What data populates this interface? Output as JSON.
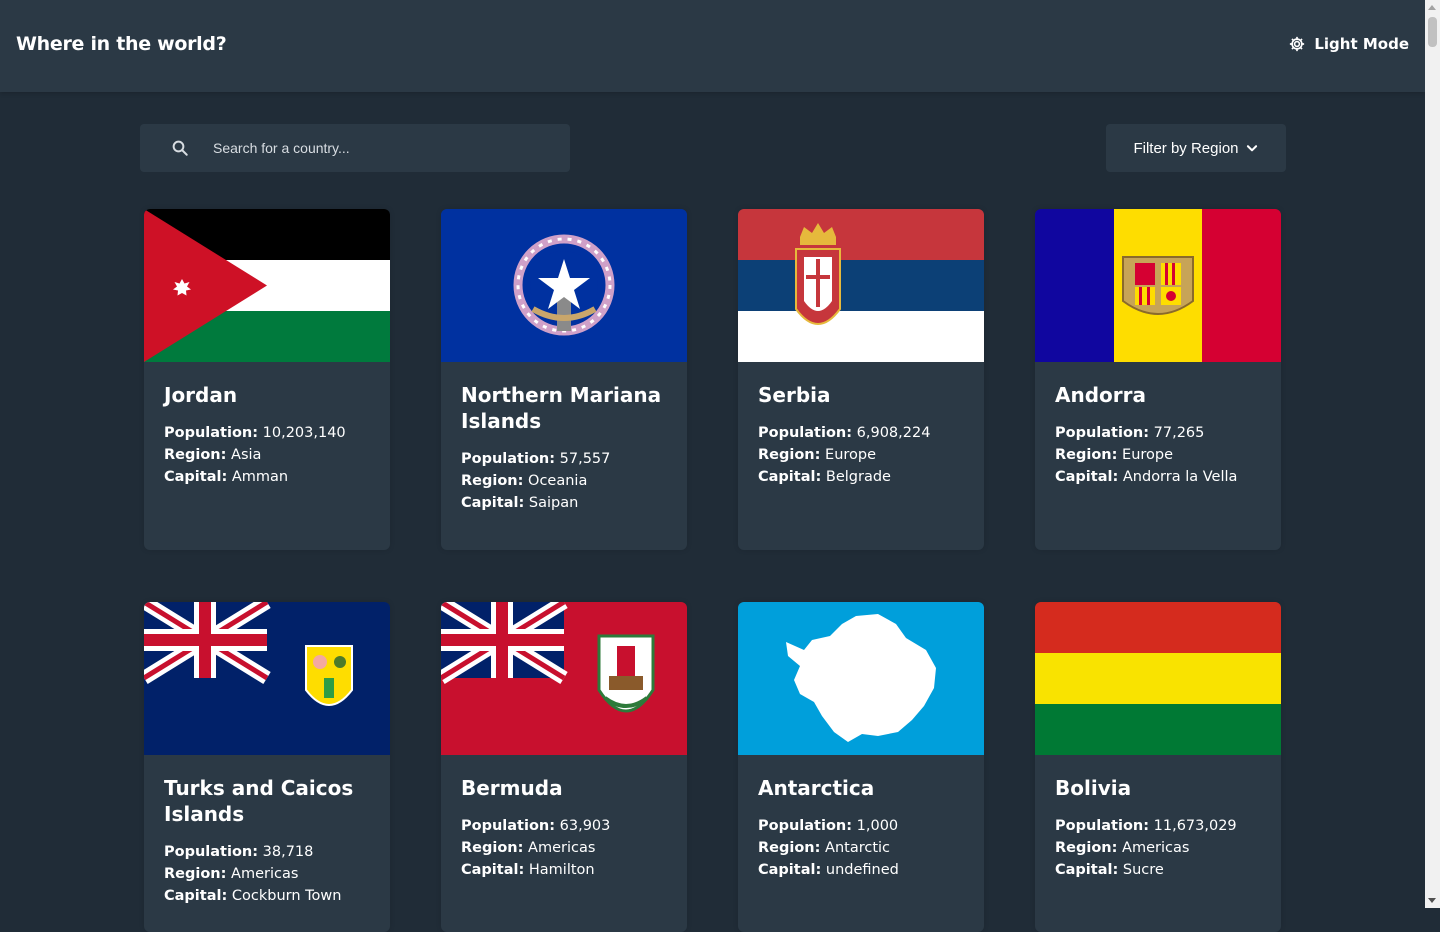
{
  "header": {
    "title": "Where in the world?",
    "mode_label": "Light Mode",
    "mode_icon": "gear-icon"
  },
  "search": {
    "placeholder": "Search for a country...",
    "value": "",
    "icon": "search-icon"
  },
  "filter": {
    "label": "Filter by Region",
    "icon": "chevron-down-icon"
  },
  "labels": {
    "population": "Population:",
    "region": "Region:",
    "capital": "Capital:"
  },
  "countries": [
    {
      "name": "Jordan",
      "population": "10,203,140",
      "region": "Asia",
      "capital": "Amman"
    },
    {
      "name": "Northern Mariana Islands",
      "population": "57,557",
      "region": "Oceania",
      "capital": "Saipan"
    },
    {
      "name": "Serbia",
      "population": "6,908,224",
      "region": "Europe",
      "capital": "Belgrade"
    },
    {
      "name": "Andorra",
      "population": "77,265",
      "region": "Europe",
      "capital": "Andorra la Vella"
    },
    {
      "name": "Turks and Caicos Islands",
      "population": "38,718",
      "region": "Americas",
      "capital": "Cockburn Town"
    },
    {
      "name": "Bermuda",
      "population": "63,903",
      "region": "Americas",
      "capital": "Hamilton"
    },
    {
      "name": "Antarctica",
      "population": "1,000",
      "region": "Antarctic",
      "capital": "undefined"
    },
    {
      "name": "Bolivia",
      "population": "11,673,029",
      "region": "Americas",
      "capital": "Sucre"
    }
  ],
  "colors": {
    "background": "#202c37",
    "element": "#2b3945",
    "text": "#ffffff"
  }
}
